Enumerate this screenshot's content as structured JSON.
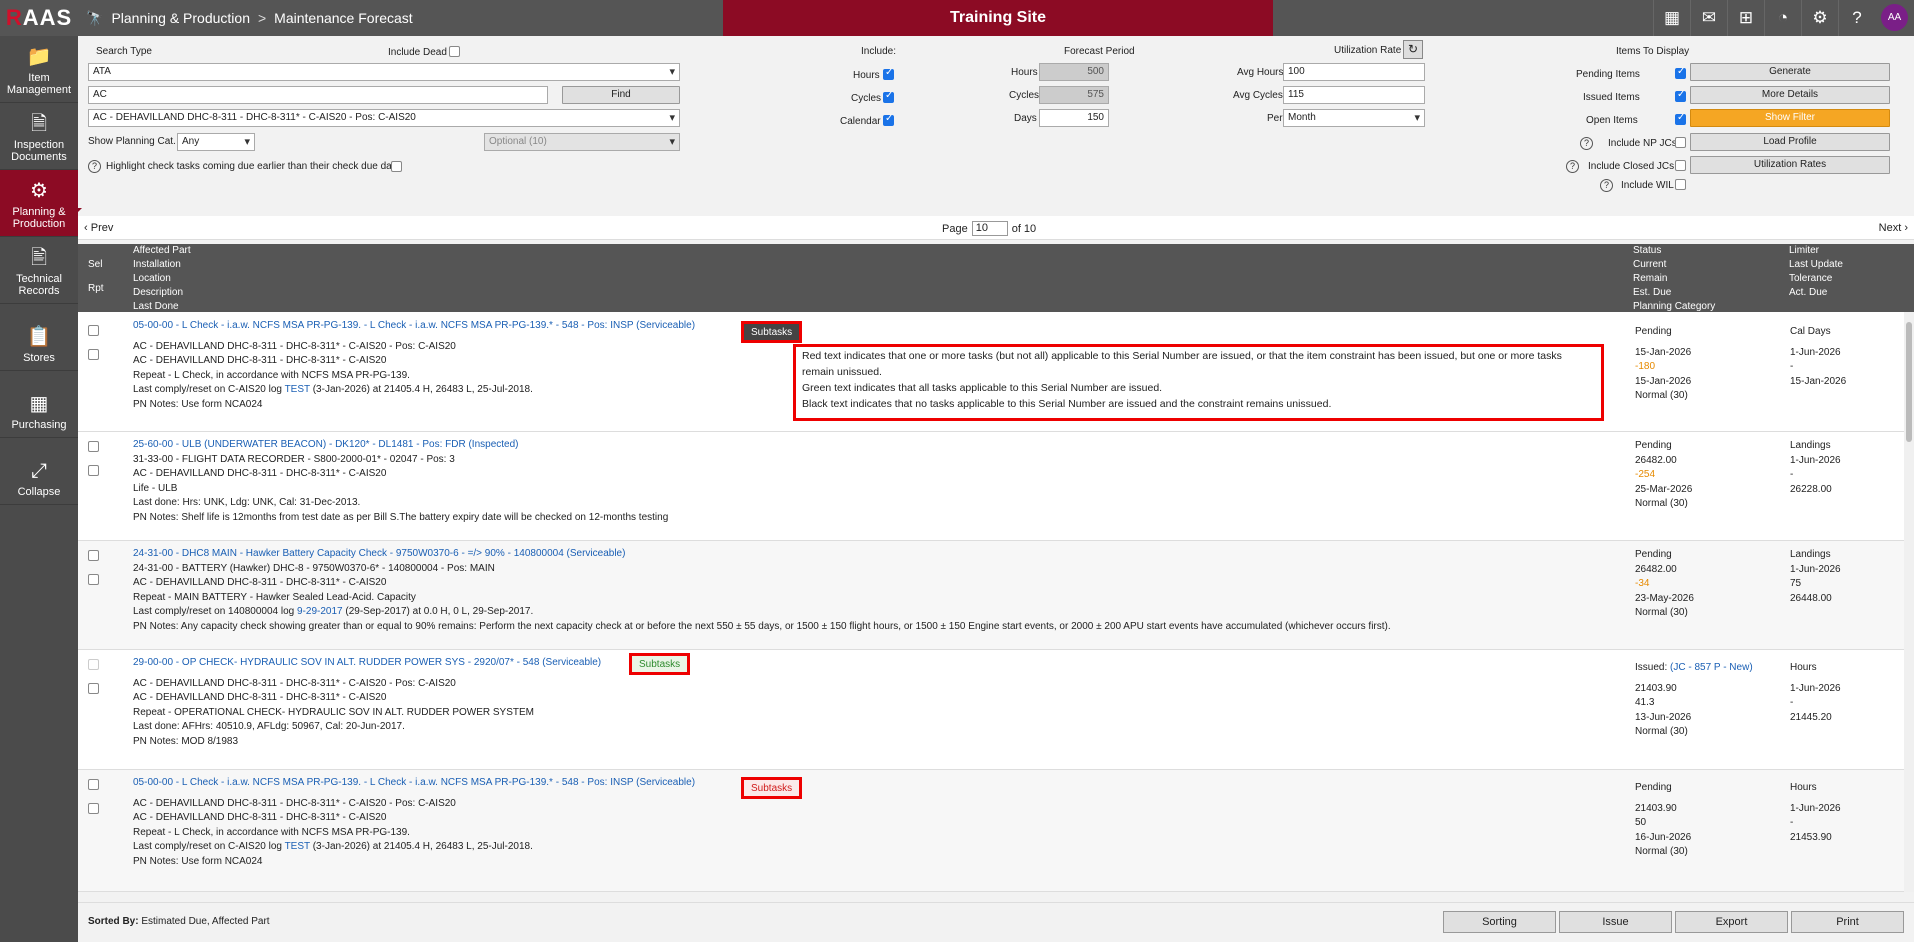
{
  "app": {
    "logo_r": "R",
    "logo_rest": "AAS",
    "breadcrumb_section": "Planning & Production",
    "breadcrumb_sep": ">",
    "breadcrumb_page": "Maintenance Forecast",
    "site_banner": "Training Site",
    "avatar": "AA"
  },
  "top_icons": [
    "contacts-icon",
    "chat-icon",
    "add-icon",
    "chart-icon",
    "settings-icon",
    "help-icon"
  ],
  "sidebar": [
    {
      "label": "Item Management",
      "icon": "folder-icon"
    },
    {
      "label": "Inspection Documents",
      "icon": "document-icon"
    },
    {
      "label": "Planning & Production",
      "icon": "workflow-icon"
    },
    {
      "label": "Technical Records",
      "icon": "records-icon"
    },
    {
      "label": "Stores",
      "icon": "clipboard-icon"
    },
    {
      "label": "Purchasing",
      "icon": "calculator-icon"
    },
    {
      "label": "Collapse",
      "icon": "collapse-icon"
    }
  ],
  "filters": {
    "search_type_label": "Search Type",
    "include_dead": "Include Dead",
    "search_type": "ATA",
    "search_text": "AC",
    "find": "Find",
    "aircraft": "AC - DEHAVILLAND DHC-8-311 - DHC-8-311* - C-AIS20 - Pos: C-AIS20",
    "show_planning_cat": "Show Planning Cat.",
    "planning_cat": "Any",
    "optional": "Optional (10)",
    "highlight": "Highlight check tasks coming due earlier than their check due date",
    "include": "Include:",
    "hours": "Hours",
    "cycles": "Cycles",
    "calendar": "Calendar",
    "forecast_period": "Forecast Period",
    "fp_hours_label": "Hours",
    "fp_hours": "500",
    "fp_cycles_label": "Cycles",
    "fp_cycles": "575",
    "fp_days_label": "Days",
    "fp_days": "150",
    "utilization_rate": "Utilization Rate",
    "avg_hours_label": "Avg Hours",
    "avg_hours": "100",
    "avg_cycles_label": "Avg Cycles",
    "avg_cycles": "115",
    "per_label": "Per",
    "per": "Month",
    "items_to_display": "Items To Display",
    "pending": "Pending Items",
    "issued": "Issued Items",
    "open": "Open Items",
    "np_jcs": "Include NP JCs",
    "closed_jcs": "Include Closed JCs",
    "wil": "Include WIL",
    "generate": "Generate",
    "more_details": "More Details",
    "show_filter": "Show Filter",
    "load_profile": "Load Profile",
    "utilization_rates": "Utilization Rates"
  },
  "pager": {
    "prev": "Prev",
    "page_label": "Page",
    "page": "10",
    "of": "of 10",
    "next": "Next"
  },
  "headers": {
    "sel": "Sel",
    "rpt": "Rpt",
    "col1": [
      "Affected Part",
      "Installation",
      "Location",
      "Description",
      "Last Done"
    ],
    "col2": [
      "Status",
      "Current",
      "Remain",
      "Est. Due",
      "Planning Category"
    ],
    "col3": [
      "Limiter",
      "Last Update",
      "Tolerance",
      "Act. Due"
    ]
  },
  "rows": [
    {
      "title": "05-00-00 - L Check - i.a.w. NCFS MSA PR-PG-139. - L Check - i.a.w. NCFS MSA PR-PG-139.* - 548 - Pos: INSP (Serviceable)",
      "lines": [
        "",
        "AC - DEHAVILLAND DHC-8-311 - DHC-8-311* - C-AIS20 - Pos: C-AIS20",
        "AC - DEHAVILLAND DHC-8-311 - DHC-8-311* - C-AIS20",
        "Repeat - L Check, in accordance with NCFS MSA PR-PG-139."
      ],
      "last_pre": "Last comply/reset on C-AIS20 log ",
      "last_link": "TEST",
      "last_post": " (3-Jan-2026) at 21405.4 H, 26483 L, 25-Jul-2018.",
      "pn": "PN Notes: Use form NCA024",
      "subtasks": "Subtasks",
      "status": [
        "Pending",
        "15-Jan-2026",
        "-180",
        "15-Jan-2026",
        "Normal (30)"
      ],
      "limiter": [
        "Cal Days",
        "1-Jun-2026",
        "-",
        "15-Jan-2026"
      ]
    },
    {
      "title": "25-60-00 - ULB (UNDERWATER BEACON) - DK120* - DL1481 - Pos: FDR (Inspected)",
      "lines": [
        "31-33-00 - FLIGHT DATA RECORDER - S800-2000-01* - 02047 - Pos: 3",
        "AC - DEHAVILLAND DHC-8-311 - DHC-8-311* - C-AIS20",
        "Life - ULB",
        "Last done: Hrs: UNK, Ldg: UNK, Cal: 31-Dec-2013."
      ],
      "pn": "PN Notes: Shelf life is 12months from test date as per Bill S.The battery expiry date will be checked on 12-months testing",
      "status": [
        "Pending",
        "26482.00",
        "-254",
        "25-Mar-2026",
        "Normal (30)"
      ],
      "limiter": [
        "Landings",
        "1-Jun-2026",
        "-",
        "26228.00"
      ]
    },
    {
      "title": "24-31-00 - DHC8 MAIN - Hawker Battery Capacity Check - 9750W0370-6 - =/> 90% - 140800004 (Serviceable)",
      "lines": [
        "24-31-00 - BATTERY (Hawker) DHC-8 - 9750W0370-6* - 140800004 - Pos: MAIN",
        "AC - DEHAVILLAND DHC-8-311 - DHC-8-311* - C-AIS20",
        "Repeat - MAIN BATTERY - Hawker Sealed Lead-Acid. Capacity"
      ],
      "last_pre": "Last comply/reset on 140800004 log ",
      "last_link": "9-29-2017",
      "last_post": " (29-Sep-2017) at 0.0 H, 0 L, 29-Sep-2017.",
      "pn": "PN Notes: Any capacity check showing greater than or equal to 90% remains: Perform the next capacity check at or before the next 550 ± 55 days, or 1500 ± 150 flight hours, or 1500 ± 150 Engine start events, or 2000 ± 200 APU start events have accumulated (whichever occurs first).",
      "status": [
        "Pending",
        "26482.00",
        "-34",
        "23-May-2026",
        "Normal (30)"
      ],
      "limiter": [
        "Landings",
        "1-Jun-2026",
        "75",
        "26448.00"
      ]
    },
    {
      "title": "29-00-00 - OP CHECK- HYDRAULIC SOV IN ALT. RUDDER POWER SYS - 2920/07* - 548 (Serviceable)",
      "lines": [
        "",
        "AC - DEHAVILLAND DHC-8-311 - DHC-8-311* - C-AIS20 - Pos: C-AIS20",
        "AC - DEHAVILLAND DHC-8-311 - DHC-8-311* - C-AIS20",
        "Repeat - OPERATIONAL CHECK- HYDRAULIC SOV IN ALT. RUDDER POWER SYSTEM",
        "Last done: AFHrs: 40510.9, AFLdg: 50967, Cal: 20-Jun-2017."
      ],
      "pn": "PN Notes: MOD 8/1983",
      "subtasks": "Subtasks",
      "status_issued": "Issued: ",
      "status_link": "(JC - 857 P - New)",
      "status": [
        "",
        "21403.90",
        "41.3",
        "13-Jun-2026",
        "Normal (30)"
      ],
      "limiter": [
        "Hours",
        "1-Jun-2026",
        "-",
        "21445.20"
      ]
    },
    {
      "title": "05-00-00 - L Check - i.a.w. NCFS MSA PR-PG-139. - L Check - i.a.w. NCFS MSA PR-PG-139.* - 548 - Pos: INSP (Serviceable)",
      "lines": [
        "",
        "AC - DEHAVILLAND DHC-8-311 - DHC-8-311* - C-AIS20 - Pos: C-AIS20",
        "AC - DEHAVILLAND DHC-8-311 - DHC-8-311* - C-AIS20",
        "Repeat - L Check, in accordance with NCFS MSA PR-PG-139."
      ],
      "last_pre": "Last comply/reset on C-AIS20 log ",
      "last_link": "TEST",
      "last_post": " (3-Jan-2026) at 21405.4 H, 26483 L, 25-Jul-2018.",
      "pn": "PN Notes: Use form NCA024",
      "subtasks": "Subtasks",
      "status": [
        "Pending",
        "21403.90",
        "50",
        "16-Jun-2026",
        "Normal (30)"
      ],
      "limiter": [
        "Hours",
        "1-Jun-2026",
        "-",
        "21453.90"
      ]
    }
  ],
  "tooltip": [
    "Red text indicates that one or more tasks (but not all) applicable to this Serial Number are issued, or that the item constraint has been issued, but one or more tasks remain unissued.",
    "Green text indicates that all tasks applicable to this Serial Number are issued.",
    "Black text indicates that no tasks applicable to this Serial Number are issued and the constraint remains unissued."
  ],
  "footer": {
    "sorted_label": "Sorted By:",
    "sorted_value": "Estimated Due, Affected Part",
    "sorting": "Sorting",
    "issue": "Issue",
    "export": "Export",
    "print": "Print"
  },
  "colors": {
    "accent": "#8c0b24",
    "link": "#1a5fb4",
    "orange": "#f5a623",
    "negative": "#e68a00",
    "highlight_border": "#e00"
  }
}
